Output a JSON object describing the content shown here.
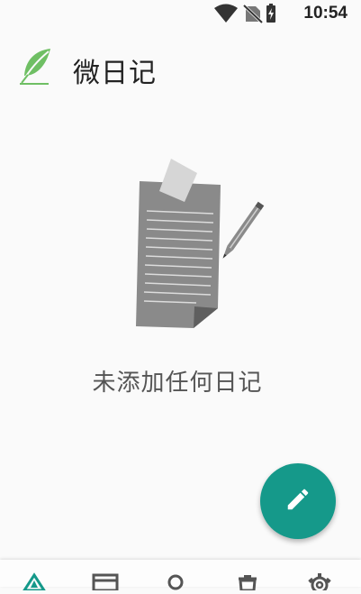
{
  "status_bar": {
    "time": "10:54",
    "icons": [
      "wifi-icon",
      "no-sim-icon",
      "battery-charging-icon"
    ]
  },
  "app_bar": {
    "title": "微日记",
    "logo_icon": "feather-leaf-icon"
  },
  "empty_state": {
    "illustration_icon": "paper-with-pencil-icon",
    "message": "未添加任何日记"
  },
  "fab": {
    "icon": "edit-pencil-icon",
    "color": "#15998a"
  },
  "bottom_nav": {
    "items": [
      {
        "id": "home",
        "icon": "home-tree-icon",
        "active": true
      },
      {
        "id": "archive",
        "icon": "archive-icon",
        "active": false
      },
      {
        "id": "search",
        "icon": "search-icon",
        "active": false
      },
      {
        "id": "trash",
        "icon": "trash-icon",
        "active": false
      },
      {
        "id": "settings",
        "icon": "settings-gear-icon",
        "active": false
      }
    ],
    "active_color": "#15998a",
    "inactive_color": "#555555"
  }
}
